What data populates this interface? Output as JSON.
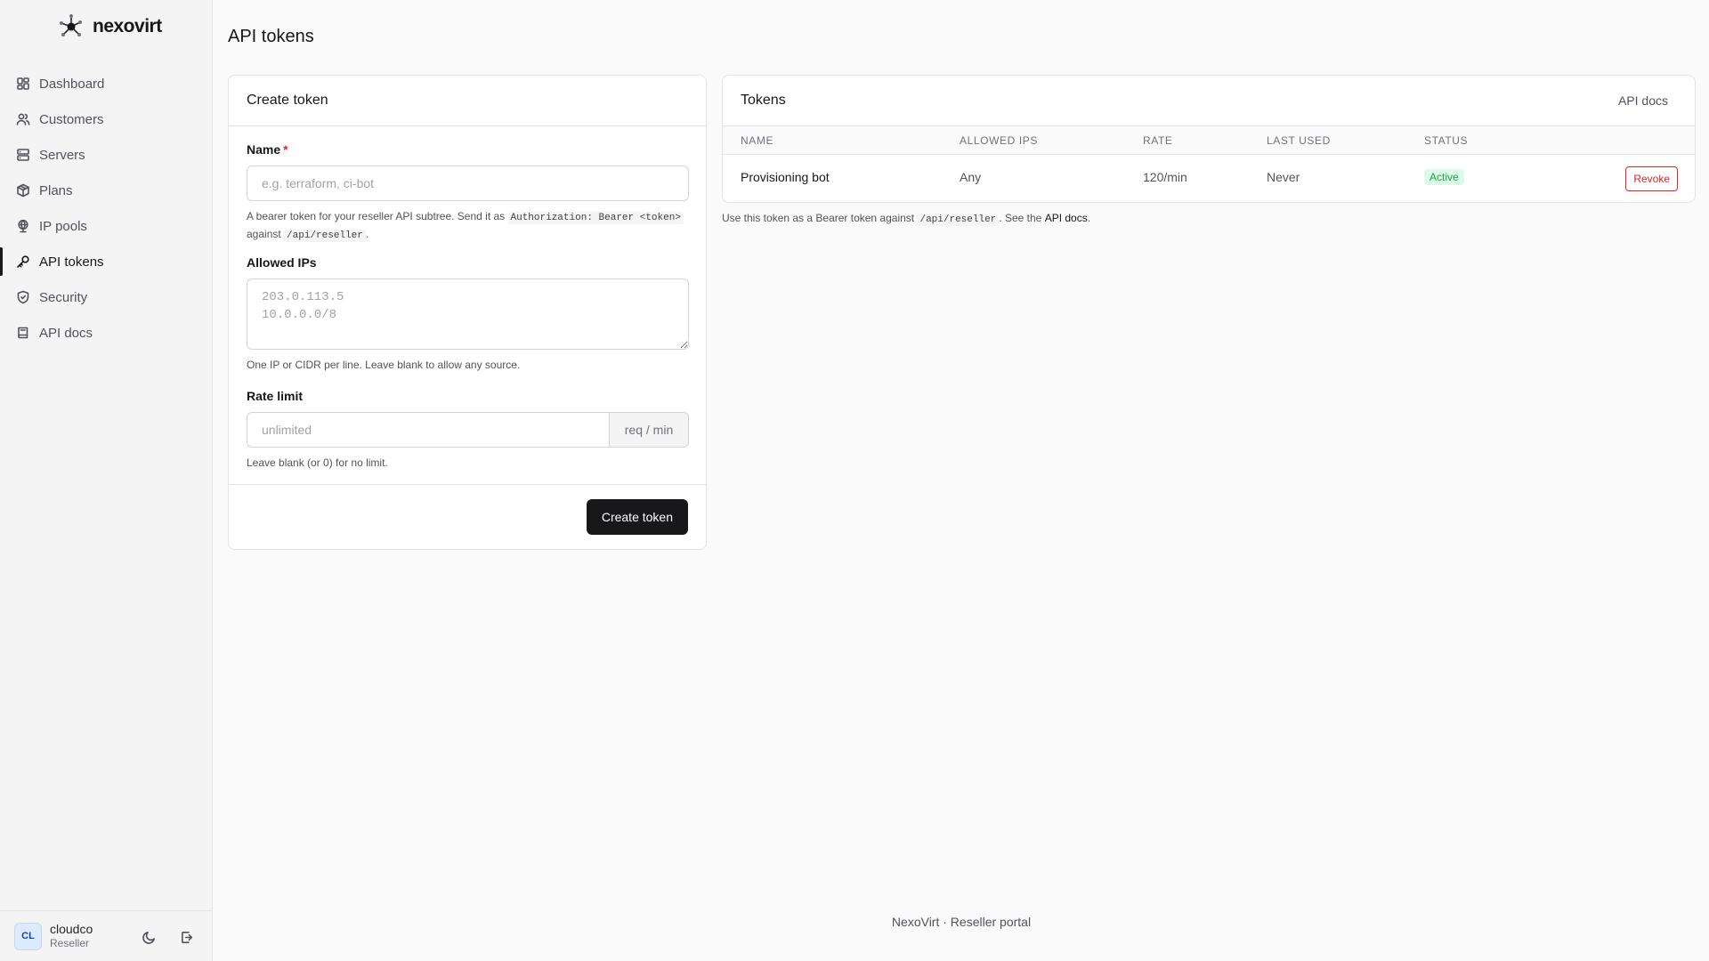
{
  "app": {
    "name": "nexovirt"
  },
  "sidebar": {
    "items": [
      {
        "label": "Dashboard",
        "icon": "grid-icon"
      },
      {
        "label": "Customers",
        "icon": "users-icon"
      },
      {
        "label": "Servers",
        "icon": "server-icon"
      },
      {
        "label": "Plans",
        "icon": "package-icon"
      },
      {
        "label": "IP pools",
        "icon": "globe-icon"
      },
      {
        "label": "API tokens",
        "icon": "key-icon",
        "active": true
      },
      {
        "label": "Security",
        "icon": "shield-icon"
      },
      {
        "label": "API docs",
        "icon": "book-icon"
      }
    ]
  },
  "user": {
    "initials": "CL",
    "name": "cloudco",
    "role": "Reseller"
  },
  "page": {
    "title": "API tokens"
  },
  "create": {
    "title": "Create token",
    "name_label": "Name",
    "required_mark": "*",
    "name_placeholder": "e.g. terraform, ci-bot",
    "name_help_1": "A bearer token for your reseller API subtree. Send it as",
    "name_help_code1": "Authorization: Bearer <token>",
    "name_help_2": "against",
    "name_help_code2": "/api/reseller",
    "name_help_3": ".",
    "ips_label": "Allowed IPs",
    "ips_placeholder": "203.0.113.5\n10.0.0.0/8",
    "ips_help": "One IP or CIDR per line. Leave blank to allow any source.",
    "rate_label": "Rate limit",
    "rate_placeholder": "unlimited",
    "rate_unit": "req / min",
    "rate_help": "Leave blank (or 0) for no limit.",
    "submit_label": "Create token"
  },
  "tokens": {
    "title": "Tokens",
    "docs_link": "API docs",
    "columns": [
      "Name",
      "Allowed IPs",
      "Rate",
      "Last used",
      "Status"
    ],
    "rows": [
      {
        "name": "Provisioning bot",
        "allowed_ips": "Any",
        "rate": "120/min",
        "last_used": "Never",
        "status": "Active",
        "action": "Revoke"
      }
    ],
    "note_1": "Use this token as a Bearer token against",
    "note_code": "/api/reseller",
    "note_2": ". See the",
    "note_link": "API docs",
    "note_3": "."
  },
  "footer": {
    "text": "NexoVirt · Reseller portal"
  },
  "colors": {
    "accent": "#18181b",
    "danger": "#dc2626",
    "success": "#16a34a"
  }
}
